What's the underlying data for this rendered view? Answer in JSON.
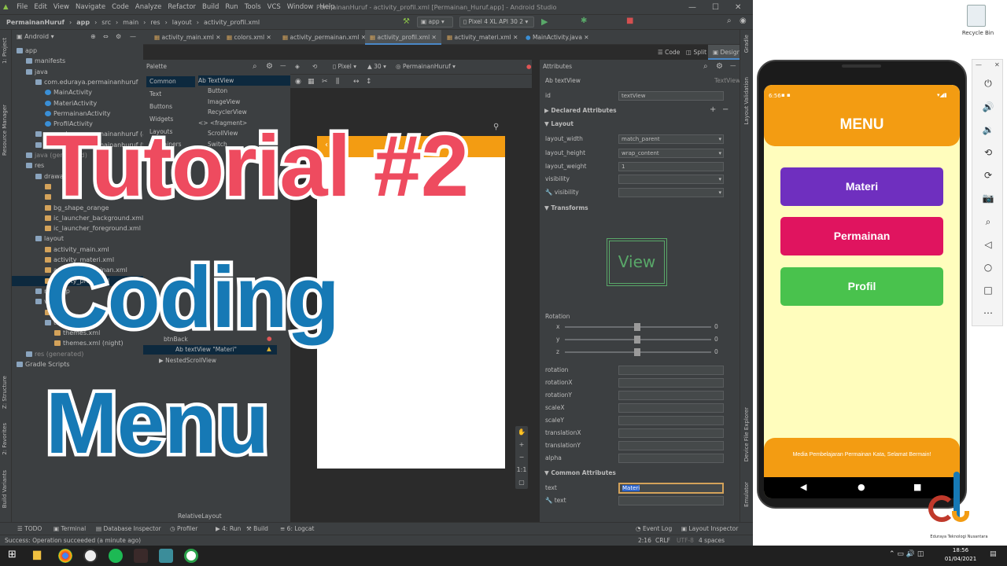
{
  "menubar": {
    "items": [
      "File",
      "Edit",
      "View",
      "Navigate",
      "Code",
      "Analyze",
      "Refactor",
      "Build",
      "Run",
      "Tools",
      "VCS",
      "Window",
      "Help"
    ],
    "title": "PermainanHuruf - activity_profil.xml [Permainan_Huruf.app] - Android Studio"
  },
  "navbar": {
    "crumbs": [
      "PermainanHuruf",
      "app",
      "src",
      "main",
      "res",
      "layout",
      "activity_profil.xml"
    ],
    "run_config": "app",
    "device": "Pixel 4 XL API 30 2"
  },
  "tabs": [
    "activity_main.xml",
    "colors.xml",
    "activity_permainan.xml",
    "activity_profil.xml",
    "activity_materi.xml",
    "MainActivity.java"
  ],
  "project": {
    "mode": "Android",
    "tree": [
      {
        "label": "app",
        "indent": 0,
        "type": "folder"
      },
      {
        "label": "manifests",
        "indent": 1,
        "type": "folder"
      },
      {
        "label": "java",
        "indent": 1,
        "type": "folder"
      },
      {
        "label": "com.eduraya.permainanhuruf",
        "indent": 2,
        "type": "folder"
      },
      {
        "label": "MainActivity",
        "indent": 3,
        "type": "cls"
      },
      {
        "label": "MateriActivity",
        "indent": 3,
        "type": "cls"
      },
      {
        "label": "PermainanActivity",
        "indent": 3,
        "type": "cls"
      },
      {
        "label": "ProfilActivity",
        "indent": 3,
        "type": "cls"
      },
      {
        "label": "com.eduraya.permainanhuruf (an",
        "indent": 2,
        "type": "folder"
      },
      {
        "label": "com.eduraya.permainanhuruf (te",
        "indent": 2,
        "type": "folder"
      },
      {
        "label": "java (generated)",
        "indent": 1,
        "type": "folder"
      },
      {
        "label": "res",
        "indent": 1,
        "type": "folder"
      },
      {
        "label": "drawable",
        "indent": 2,
        "type": "folder"
      },
      {
        "label": "",
        "indent": 3,
        "type": "xml"
      },
      {
        "label": "",
        "indent": 3,
        "type": "xml"
      },
      {
        "label": "bg_shape_orange",
        "indent": 3,
        "type": "xml"
      },
      {
        "label": "ic_launcher_background.xml",
        "indent": 3,
        "type": "xml"
      },
      {
        "label": "ic_launcher_foreground.xml (v24)",
        "indent": 3,
        "type": "xml"
      },
      {
        "label": "layout",
        "indent": 2,
        "type": "folder"
      },
      {
        "label": "activity_main.xml",
        "indent": 3,
        "type": "xml"
      },
      {
        "label": "activity_materi.xml",
        "indent": 3,
        "type": "xml"
      },
      {
        "label": "activity_permainan.xml",
        "indent": 3,
        "type": "xml"
      },
      {
        "label": "activity_profil.xml",
        "indent": 3,
        "type": "xml"
      },
      {
        "label": "mipmap",
        "indent": 2,
        "type": "folder"
      },
      {
        "label": "values",
        "indent": 2,
        "type": "folder"
      },
      {
        "label": "",
        "indent": 3,
        "type": "xml"
      },
      {
        "label": "themes",
        "indent": 3,
        "type": "folder"
      },
      {
        "label": "themes.xml",
        "indent": 4,
        "type": "xml"
      },
      {
        "label": "themes.xml (night)",
        "indent": 4,
        "type": "xml"
      },
      {
        "label": "res (generated)",
        "indent": 1,
        "type": "folder"
      },
      {
        "label": "Gradle Scripts",
        "indent": 0,
        "type": "folder"
      }
    ]
  },
  "palette": {
    "title": "Palette",
    "categories": [
      "Common",
      "Text",
      "Buttons",
      "Widgets",
      "Layouts",
      "Containers"
    ],
    "items": [
      "Ab TextView",
      "Button",
      "ImageView",
      "RecyclerView",
      "<> <fragment>",
      "ScrollView",
      "Switch"
    ]
  },
  "component_tree": {
    "items": [
      "btnBack",
      "Ab textView \"Materi\"",
      "NestedScrollView"
    ]
  },
  "design_toolbar": {
    "device": "Pixel",
    "api": "30",
    "theme": "PermainanHuruf"
  },
  "view_modes": [
    "Code",
    "Split",
    "Design"
  ],
  "attributes": {
    "title": "Attributes",
    "widget": "Ab textView",
    "widget_type": "TextView",
    "id": "textView",
    "sections": {
      "declared": "Declared Attributes",
      "layout": "Layout",
      "transforms": "Transforms",
      "common": "Common Attributes"
    },
    "layout_rows": [
      {
        "name": "layout_width",
        "value": "match_parent"
      },
      {
        "name": "layout_height",
        "value": "wrap_content"
      },
      {
        "name": "layout_weight",
        "value": "1"
      },
      {
        "name": "visibility",
        "value": ""
      },
      {
        "name": "visibility",
        "value": ""
      }
    ],
    "preview_label": "View",
    "rotation": {
      "label": "Rotation",
      "x": "0",
      "y": "0",
      "z": "0"
    },
    "transform_rows": [
      "rotation",
      "rotationX",
      "rotationY",
      "scaleX",
      "scaleY",
      "translationX",
      "translationY",
      "alpha"
    ],
    "text_rows": [
      {
        "name": "text",
        "value": "Materi"
      },
      {
        "name": "text",
        "value": ""
      }
    ]
  },
  "bottom_tools": [
    "TODO",
    "Terminal",
    "Database Inspector",
    "Profiler",
    "4: Run",
    "Build",
    "6: Logcat",
    "Event Log",
    "Layout Inspector"
  ],
  "bottom_layout": "RelativeLayout",
  "status": {
    "message": "Success: Operation succeeded (a minute ago)",
    "position": "2:16",
    "crlf": "CRLF",
    "encoding": "UTF-8",
    "indent": "4 spaces"
  },
  "overlay": {
    "line1": "Tutorial #2",
    "line2": "Coding",
    "line3": "Menu"
  },
  "emulator": {
    "time": "6:56",
    "app_title": "MENU",
    "buttons": [
      "Materi",
      "Permainan",
      "Profil"
    ],
    "footer": "Media Pembelajaran Permainan Kata, Selamat Bermain!"
  },
  "desktop": {
    "recycle_bin": "Recycle Bin",
    "brand": "Eduraya Teknologi Nusantara"
  },
  "taskbar": {
    "time": "18:56",
    "date": "01/04/2021"
  },
  "colors": {
    "orange": "#f39c12",
    "purple": "#6f2fbf",
    "pink": "#e0145f",
    "green": "#49c24d",
    "screen_bg": "#fffdbd"
  }
}
